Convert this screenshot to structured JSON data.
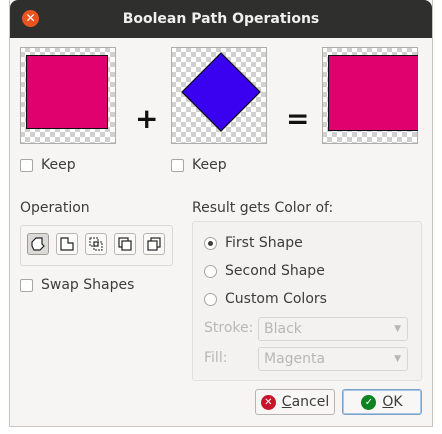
{
  "window": {
    "title": "Boolean Path Operations"
  },
  "shapes": {
    "first_color": "#e0006e",
    "second_color": "#3a00f0",
    "result_color": "#e0006e",
    "plus_symbol": "+",
    "equals_symbol": "=",
    "keep_label_1": "Keep",
    "keep_label_2": "Keep"
  },
  "operation": {
    "label": "Operation",
    "buttons": [
      "union-icon",
      "difference-icon",
      "intersection-icon",
      "exclusion-icon",
      "reverse-difference-icon"
    ],
    "active_index": 0,
    "swap_label": "Swap Shapes"
  },
  "result_color": {
    "label": "Result gets Color of:",
    "options": [
      "First Shape",
      "Second Shape",
      "Custom Colors"
    ],
    "selected": "First Shape",
    "stroke_label": "Stroke:",
    "stroke_value": "Black",
    "fill_label": "Fill:",
    "fill_value": "Magenta"
  },
  "buttons": {
    "cancel_first": "C",
    "cancel_rest": "ancel",
    "ok_first": "O",
    "ok_rest": "K"
  },
  "colors": {
    "titlebar": "#2f2f2d",
    "close": "#e95420",
    "cancel_icon": "#c7162b",
    "ok_icon": "#0e8420"
  }
}
